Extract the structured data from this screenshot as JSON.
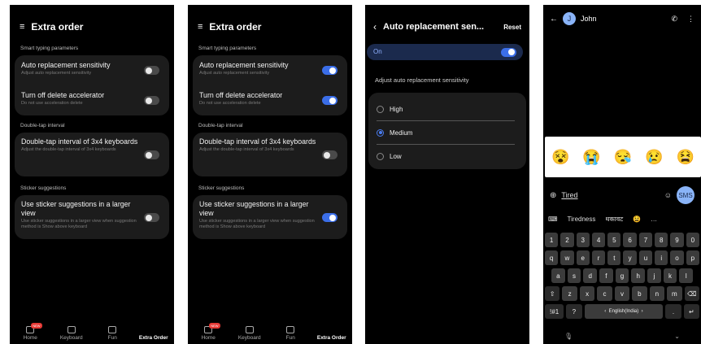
{
  "panel1": {
    "title": "Extra order",
    "sections": {
      "smart": "Smart typing parameters",
      "double": "Double-tap interval",
      "sticker": "Sticker suggestions"
    },
    "rows": [
      {
        "title": "Auto replacement sensitivity",
        "desc": "Adjust auto replacement sensitivity",
        "on": false
      },
      {
        "title": "Turn off delete accelerator",
        "desc": "Do not use acceleration delete",
        "on": false
      },
      {
        "title": "Double-tap interval of 3x4 keyboards",
        "desc": "Adjust the double-tap interval of 3x4 keyboards",
        "on": false
      },
      {
        "title": "Use sticker suggestions in a larger view",
        "desc": "Use sticker suggestions in a larger view when suggestion method is Show above keyboard",
        "on": false
      }
    ],
    "nav": {
      "home": "Home",
      "badge": "NEW",
      "keyboard": "Keyboard",
      "fun": "Fun",
      "extra": "Extra Order"
    }
  },
  "panel2": {
    "title": "Extra order",
    "sections": {
      "smart": "Smart typing parameters",
      "double": "Double-tap interval",
      "sticker": "Sticker suggestions"
    },
    "rows": [
      {
        "title": "Auto replacement sensitivity",
        "desc": "Adjust auto replacement sensitivity",
        "on": true
      },
      {
        "title": "Turn off delete accelerator",
        "desc": "Do not use acceleration delete",
        "on": true
      },
      {
        "title": "Double-tap interval of 3x4 keyboards",
        "desc": "Adjust the double-tap interval of 3x4 keyboards",
        "on": false
      },
      {
        "title": "Use sticker suggestions in a larger view",
        "desc": "Use sticker suggestions in a larger view when suggestion method is Show above keyboard",
        "on": true
      }
    ],
    "nav": {
      "home": "Home",
      "badge": "NEW",
      "keyboard": "Keyboard",
      "fun": "Fun",
      "extra": "Extra Order"
    }
  },
  "panel3": {
    "title": "Auto replacement sen...",
    "reset": "Reset",
    "on_label": "On",
    "adjust_label": "Adjust auto replacement sensitivity",
    "options": [
      "High",
      "Medium",
      "Low"
    ],
    "selected": "Medium"
  },
  "panel4": {
    "contact": "John",
    "avatar_letter": "J",
    "compose_text": "Tired",
    "send_label": "SMS",
    "suggestions": [
      "Tiredness",
      "थकावट"
    ],
    "keys": {
      "numbers": [
        "1",
        "2",
        "3",
        "4",
        "5",
        "6",
        "7",
        "8",
        "9",
        "0"
      ],
      "row1": [
        "q",
        "w",
        "e",
        "r",
        "t",
        "y",
        "u",
        "i",
        "o",
        "p"
      ],
      "row2": [
        "a",
        "s",
        "d",
        "f",
        "g",
        "h",
        "j",
        "k",
        "l"
      ],
      "row3": [
        "z",
        "x",
        "c",
        "v",
        "b",
        "n",
        "m"
      ],
      "sym": "!#1",
      "q": "?",
      "lang": "English(India)"
    },
    "icons": {
      "back": "arrow-left-icon",
      "call": "phone-icon",
      "more": "more-icon"
    }
  }
}
